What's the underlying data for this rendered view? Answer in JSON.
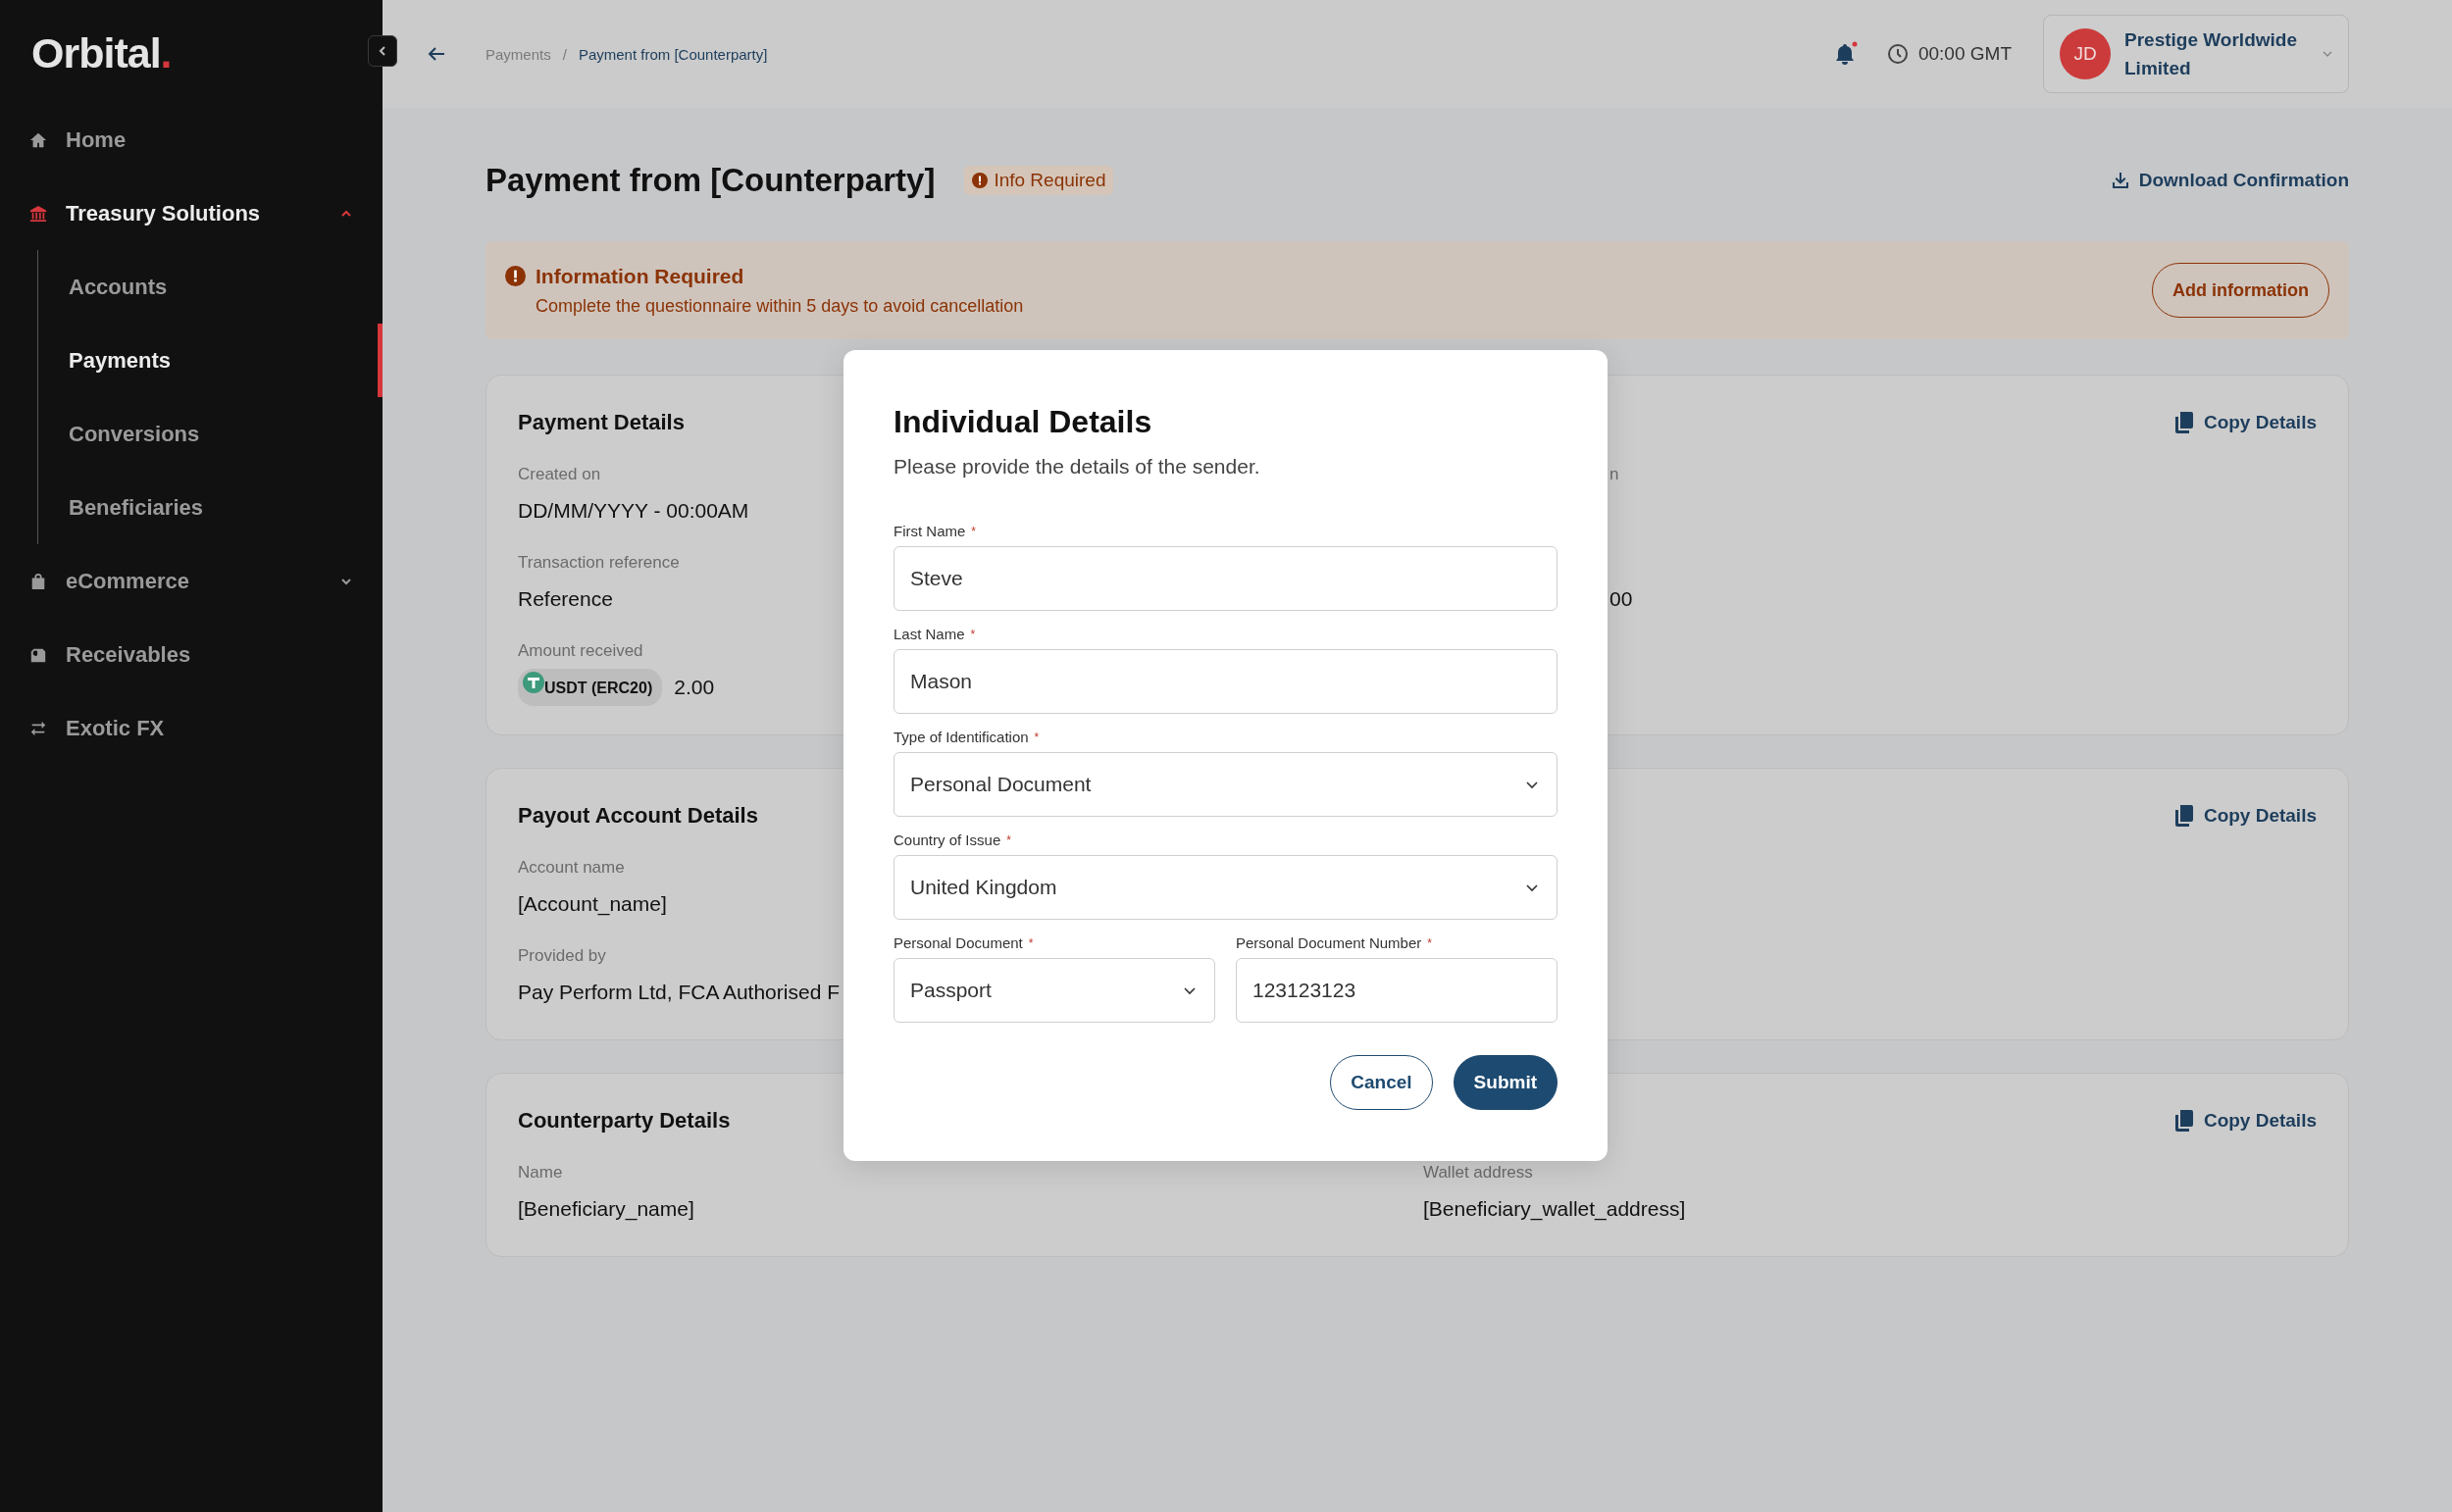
{
  "sidebar": {
    "logo": {
      "text": "Orbital",
      "mark": "."
    },
    "items": [
      {
        "label": "Home",
        "selected": false
      },
      {
        "label": "Treasury Solutions",
        "selected": true,
        "expanded": true,
        "children": [
          {
            "label": "Accounts",
            "selected": false
          },
          {
            "label": "Payments",
            "selected": true
          },
          {
            "label": "Conversions",
            "selected": false
          },
          {
            "label": "Beneficiaries",
            "selected": false
          }
        ]
      },
      {
        "label": "eCommerce",
        "selected": false,
        "expanded": false
      },
      {
        "label": "Receivables",
        "selected": false
      },
      {
        "label": "Exotic FX",
        "selected": false
      }
    ]
  },
  "header": {
    "breadcrumb": [
      {
        "label": "Payments",
        "current": false
      },
      {
        "label": "Payment from [Counterparty]",
        "current": true
      }
    ],
    "separator": "/",
    "notifications": true,
    "time": "00:00 GMT",
    "account": {
      "initials": "JD",
      "name": "Prestige Worldwide Limited"
    }
  },
  "page": {
    "title": "Payment from [Counterparty]",
    "status": "Info Required",
    "download": "Download Confirmation"
  },
  "alert": {
    "title": "Information Required",
    "message": "Complete the questionnaire within 5 days to avoid cancellation",
    "action": "Add information"
  },
  "cards": [
    {
      "title": "Payment Details",
      "copy": "Copy Details",
      "left": [
        {
          "label": "Created on",
          "value": "DD/MM/YYYY - 00:00AM"
        },
        {
          "label": "Transaction reference",
          "value": "Reference"
        },
        {
          "label": "Amount received",
          "token": "USDT (ERC20)",
          "value": "2.00"
        }
      ],
      "right": [
        {
          "label": "n",
          "partial": true
        },
        {
          "value": "00",
          "partial": true
        }
      ]
    },
    {
      "title": "Payout Account Details",
      "copy": "Copy Details",
      "left": [
        {
          "label": "Account name",
          "value": "[Account_name]"
        },
        {
          "label": "Provided by",
          "value": "Pay Perform Ltd, FCA Authorised F"
        }
      ]
    },
    {
      "title": "Counterparty Details",
      "copy": "Copy Details",
      "left": [
        {
          "label": "Name",
          "value": "[Beneficiary_name]"
        }
      ],
      "right": [
        {
          "label": "Wallet address",
          "value": "[Beneficiary_wallet_address]"
        }
      ]
    }
  ],
  "modal": {
    "title": "Individual Details",
    "subtitle": "Please provide the details of the sender.",
    "rows": [
      [
        {
          "kind": "text",
          "label": "First Name",
          "required_mark": "*",
          "value": "Steve"
        }
      ],
      [
        {
          "kind": "text",
          "label": "Last Name",
          "required_mark": "*",
          "value": "Mason"
        }
      ],
      [
        {
          "kind": "select",
          "label": "Type of Identification",
          "required_mark": "*",
          "value": "Personal Document"
        }
      ],
      [
        {
          "kind": "select",
          "label": "Country of Issue",
          "required_mark": "*",
          "value": "United Kingdom"
        }
      ],
      [
        {
          "kind": "select",
          "label": "Personal Document",
          "required_mark": "*",
          "value": "Passport"
        },
        {
          "kind": "text",
          "label": "Personal Document Number",
          "required_mark": "*",
          "value": "123123123"
        }
      ]
    ],
    "buttons": [
      {
        "label": "Cancel",
        "primary": false
      },
      {
        "label": "Submit",
        "primary": true
      }
    ]
  }
}
